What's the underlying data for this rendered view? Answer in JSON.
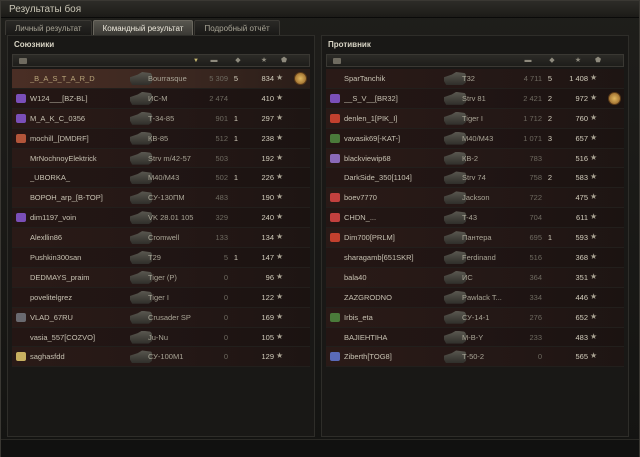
{
  "window": {
    "title": "Результаты боя"
  },
  "tabs": [
    {
      "label": "Личный результат",
      "active": false
    },
    {
      "label": "Командный результат",
      "active": true
    },
    {
      "label": "Подробный отчёт",
      "active": false
    }
  ],
  "colors": {
    "row_bg": "#2a1a17",
    "highlight_row": "#4a2e25",
    "text": "#c7c2b2",
    "accent_gold": "#c8b870"
  },
  "allies": {
    "title": "Союзники",
    "rows": [
      {
        "player": "_B_A_S_T_A_R_D",
        "tank": "Bourrasque",
        "damage": "5 309",
        "kills": "5",
        "xp": "834",
        "medal": true,
        "self": true,
        "clan": "none"
      },
      {
        "player": "W124___[BZ-BL]",
        "tank": "ИС-М",
        "damage": "2 474",
        "kills": "",
        "xp": "410",
        "clan": "#7a4fb8"
      },
      {
        "player": "M_A_K_C_0356",
        "tank": "Т-34-85",
        "damage": "901",
        "kills": "1",
        "xp": "297",
        "clan": "#7a4fb8"
      },
      {
        "player": "mochill_[DMDRF]",
        "tank": "КВ-85",
        "damage": "512",
        "kills": "1",
        "xp": "238",
        "clan": "#b2553a"
      },
      {
        "player": "MrNochnoyElektrick",
        "tank": "Strv m/42-57",
        "damage": "503",
        "kills": "",
        "xp": "192",
        "clan": "none"
      },
      {
        "player": "_UBORKA_",
        "tank": "M40/M43",
        "damage": "502",
        "kills": "1",
        "xp": "226",
        "clan": "none"
      },
      {
        "player": "ВОРОН_arp_[B-TOP]",
        "tank": "СУ-130ПМ",
        "damage": "483",
        "kills": "",
        "xp": "190",
        "clan": "none"
      },
      {
        "player": "dim1197_voin",
        "tank": "VK 28.01 105",
        "damage": "329",
        "kills": "",
        "xp": "240",
        "clan": "#7a4fb8"
      },
      {
        "player": "Alexllin86",
        "tank": "Cromwell",
        "damage": "133",
        "kills": "",
        "xp": "134",
        "clan": "none"
      },
      {
        "player": "Pushkin300san",
        "tank": "T29",
        "damage": "5",
        "kills": "1",
        "xp": "147",
        "clan": "none"
      },
      {
        "player": "DEDMAYS_praim",
        "tank": "Tiger (P)",
        "damage": "0",
        "kills": "",
        "xp": "96",
        "clan": "none"
      },
      {
        "player": "povelitelgrez",
        "tank": "Tiger I",
        "damage": "0",
        "kills": "",
        "xp": "122",
        "clan": "none"
      },
      {
        "player": "VLAD_67RU",
        "tank": "Crusader SP",
        "damage": "0",
        "kills": "",
        "xp": "169",
        "clan": "#6a6a70"
      },
      {
        "player": "vasia_557[COZVO]",
        "tank": "Ju-Nu",
        "damage": "0",
        "kills": "",
        "xp": "105",
        "clan": "none"
      },
      {
        "player": "saghasfdd",
        "tank": "СУ-100М1",
        "damage": "0",
        "kills": "",
        "xp": "129",
        "clan": "#c8b060"
      }
    ]
  },
  "enemies": {
    "title": "Противник",
    "rows": [
      {
        "player": "SparTanchik",
        "tank": "T32",
        "damage": "4 711",
        "kills": "5",
        "xp": "1 408",
        "clan": "none"
      },
      {
        "player": "__S_V__[BR32]",
        "tank": "Strv 81",
        "damage": "2 421",
        "kills": "2",
        "xp": "972",
        "medal": true,
        "clan": "#7a4fb8"
      },
      {
        "player": "denlen_1[PIK_I]",
        "tank": "Tiger I",
        "damage": "1 712",
        "kills": "2",
        "xp": "760",
        "clan": "#c2402e"
      },
      {
        "player": "vavasik69[-KAT-]",
        "tank": "M40/M43",
        "damage": "1 071",
        "kills": "3",
        "xp": "657",
        "clan": "#4a7a3a"
      },
      {
        "player": "blackviewip68",
        "tank": "КВ-2",
        "damage": "783",
        "kills": "",
        "xp": "516",
        "clan": "#8a6ab8"
      },
      {
        "player": "DarkSide_350[1104]",
        "tank": "Strv 74",
        "damage": "758",
        "kills": "2",
        "xp": "583",
        "clan": "none"
      },
      {
        "player": "boev7770",
        "tank": "Jackson",
        "damage": "722",
        "kills": "",
        "xp": "475",
        "clan": "#c2403e"
      },
      {
        "player": "CHDN_...",
        "tank": "T-43",
        "damage": "704",
        "kills": "",
        "xp": "611",
        "clan": "#c2403e"
      },
      {
        "player": "Dim700[PRLM]",
        "tank": "Пантера",
        "damage": "695",
        "kills": "1",
        "xp": "593",
        "clan": "#c2402e"
      },
      {
        "player": "sharagamb[651SKR]",
        "tank": "Ferdinand",
        "damage": "516",
        "kills": "",
        "xp": "368",
        "clan": "none"
      },
      {
        "player": "bala40",
        "tank": "ИС",
        "damage": "364",
        "kills": "",
        "xp": "351",
        "clan": "none"
      },
      {
        "player": "ZAZGRODNO",
        "tank": "Pawlack T...",
        "damage": "334",
        "kills": "",
        "xp": "446",
        "clan": "none"
      },
      {
        "player": "Irbis_eta",
        "tank": "СУ-14-1",
        "damage": "276",
        "kills": "",
        "xp": "652",
        "clan": "#4a7a3a"
      },
      {
        "player": "BAJIEHTIHA",
        "tank": "M-B-Y",
        "damage": "233",
        "kills": "",
        "xp": "483",
        "clan": "none"
      },
      {
        "player": "Ziberth[TOG8]",
        "tank": "Т-50-2",
        "damage": "0",
        "kills": "",
        "xp": "565",
        "clan": "#5a6ab8"
      }
    ]
  }
}
